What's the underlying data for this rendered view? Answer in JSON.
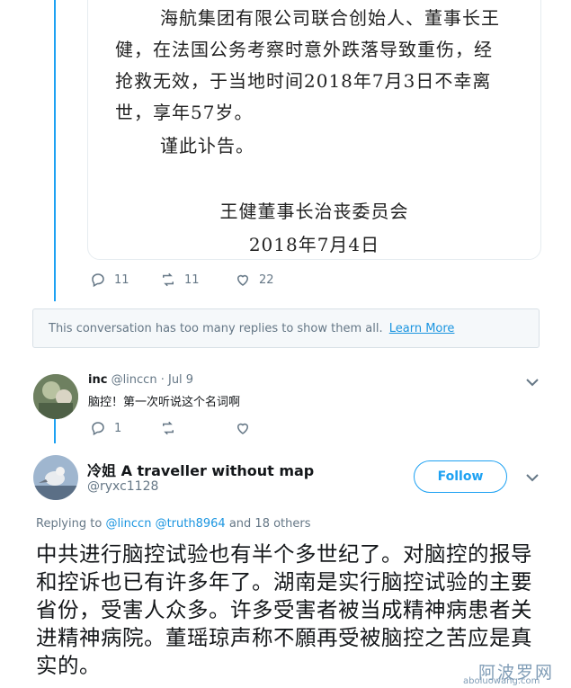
{
  "notice": {
    "lines": [
      "海航集团有限公司联合创始人、董事长王",
      "健，在法国公务考察时意外跌落导致重伤，经",
      "抢救无效，于当地时间2018年7月3日不幸离",
      "世，享年57岁。",
      "谨此讣告。"
    ],
    "signature": "王健董事长治丧委员会",
    "date": "2018年7月4日"
  },
  "tweet1": {
    "replies": "11",
    "retweets": "11",
    "likes": "22"
  },
  "banner": {
    "text": "This conversation has too many replies to show them all.",
    "link": "Learn More"
  },
  "reply": {
    "name": "inc",
    "handle": "@linccn",
    "sep": "·",
    "date": "Jul 9",
    "text": "脑控！第一次听说这个名词啊",
    "replies": "1",
    "retweets": "",
    "likes": ""
  },
  "main_tweet": {
    "name": "冷姐 A traveller without map",
    "handle": "@ryxc1128",
    "follow_label": "Follow",
    "replying_prefix": "Replying to",
    "replying_mention1": "@linccn",
    "replying_mention2": "@truth8964",
    "replying_suffix": "and 18 others",
    "body": "中共进行脑控试验也有半个多世纪了。对脑控的报导和控诉也已有许多年了。湖南是实行脑控试验的主要省份，受害人众多。许多受害者被当成精神病患者关进精神病院。董瑶琼声称不願再受被脑控之苦应是真实的。"
  },
  "watermark": {
    "title": "阿波罗网",
    "url": "aboluowang.com"
  },
  "colors": {
    "accent": "#1da1f2",
    "link": "#1b95e0",
    "muted": "#657786"
  }
}
